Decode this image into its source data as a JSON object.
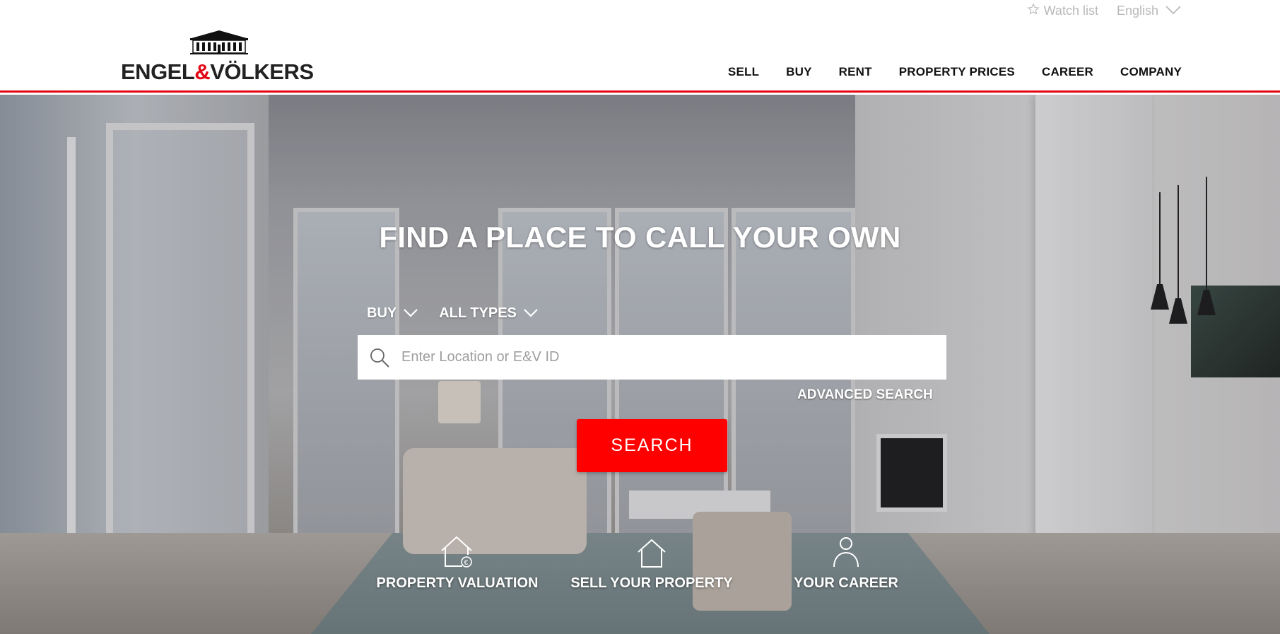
{
  "topbar": {
    "watchlist_label": "Watch list",
    "language_label": "English"
  },
  "logo": {
    "brand_left": "ENGEL",
    "brand_amp": "&",
    "brand_right": "VÖLKERS"
  },
  "nav": {
    "items": [
      {
        "label": "SELL"
      },
      {
        "label": "BUY"
      },
      {
        "label": "RENT"
      },
      {
        "label": "PROPERTY PRICES"
      },
      {
        "label": "CAREER"
      },
      {
        "label": "COMPANY"
      }
    ]
  },
  "hero": {
    "title": "FIND A PLACE TO CALL YOUR OWN",
    "filters": {
      "mode": "BUY",
      "type": "ALL TYPES"
    },
    "search": {
      "placeholder": "Enter Location or E&V ID",
      "value": ""
    },
    "advanced_search_label": "ADVANCED SEARCH",
    "search_button_label": "SEARCH",
    "quick_links": [
      {
        "label": "PROPERTY VALUATION",
        "icon": "house-euro-icon"
      },
      {
        "label": "SELL YOUR PROPERTY",
        "icon": "house-icon"
      },
      {
        "label": "YOUR CAREER",
        "icon": "person-icon"
      }
    ]
  },
  "colors": {
    "accent": "#e30613",
    "button": "#ff0000",
    "nav_text": "#111111",
    "topbar_text": "#b9b9b9"
  }
}
